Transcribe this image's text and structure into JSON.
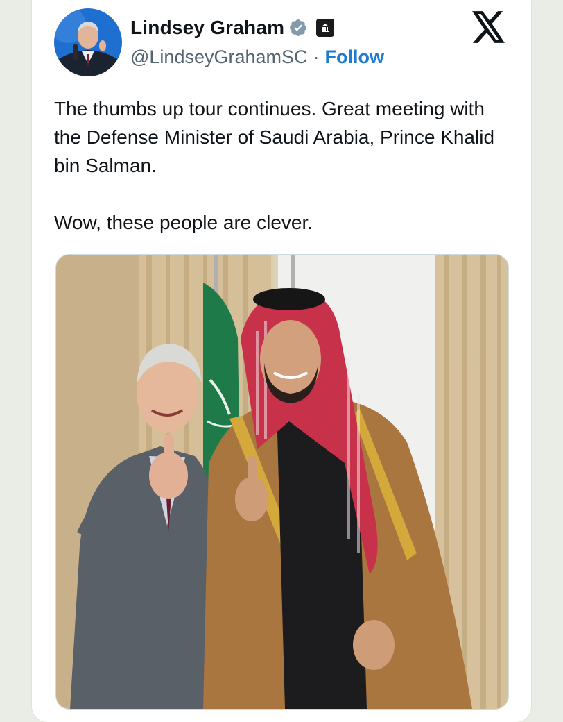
{
  "tweet": {
    "author": {
      "name": "Lindsey Graham",
      "handle": "@LindseyGrahamSC",
      "separator": "·",
      "follow_label": "Follow",
      "verified_icon": "verified-badge-icon",
      "affiliation_icon": "government-building-icon"
    },
    "platform_icon": "x-logo-icon",
    "text": [
      "The thumbs up tour continues. Great meeting with the Defense Minister of Saudi Arabia, Prince Khalid bin Salman.",
      "Wow, these people are clever."
    ],
    "media": {
      "type": "photo",
      "subject": "two men in a meeting room giving a thumbs up"
    }
  },
  "colors": {
    "text_primary": "#0f1419",
    "text_secondary": "#536471",
    "link": "#1d7bd0",
    "verified": "#829aab",
    "background": "#e9ede5",
    "card": "#ffffff"
  }
}
